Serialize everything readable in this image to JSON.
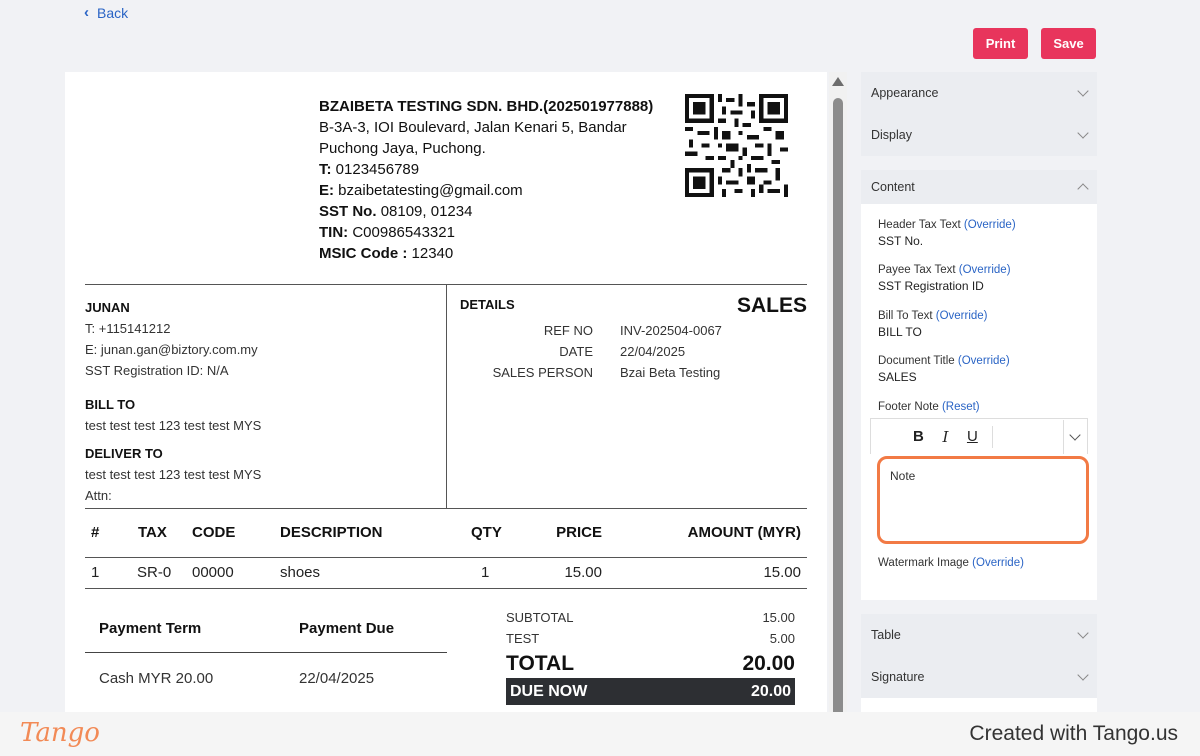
{
  "nav": {
    "back_label": "Back"
  },
  "actions": {
    "print_label": "Print",
    "save_label": "Save"
  },
  "invoice": {
    "company_name": "BZAIBETA TESTING SDN. BHD.(202501977888)",
    "address_line1": "B-3A-3, IOI Boulevard, Jalan Kenari 5, Bandar",
    "address_line2": "Puchong Jaya, Puchong.",
    "phone_label": "T:",
    "phone": "0123456789",
    "email_label": "E:",
    "email": "bzaibetatesting@gmail.com",
    "sst_label": "SST No.",
    "sst": "08109, 01234",
    "tin_label": "TIN:",
    "tin": "C00986543321",
    "msic_label": "MSIC Code :",
    "msic": "12340",
    "customer": {
      "name": "JUNAN",
      "phone": "T: +115141212",
      "email": "E: junan.gan@biztory.com.my",
      "sst": "SST Registration ID: N/A",
      "bill_to_label": "BILL TO",
      "bill_to": "test test test 123 test test MYS",
      "deliver_to_label": "DELIVER TO",
      "deliver_to": "test test test 123 test test MYS",
      "attn": "Attn:"
    },
    "details_label": "DETAILS",
    "doc_title": "SALES",
    "meta": [
      {
        "k": "REF NO",
        "v": "INV-202504-0067"
      },
      {
        "k": "DATE",
        "v": "22/04/2025"
      },
      {
        "k": "SALES PERSON",
        "v": "Bzai Beta Testing"
      }
    ],
    "table": {
      "headers": [
        "#",
        "TAX",
        "CODE",
        "DESCRIPTION",
        "QTY",
        "PRICE",
        "AMOUNT (MYR)"
      ],
      "rows": [
        [
          "1",
          "SR-0",
          "00000",
          "shoes",
          "1",
          "15.00",
          "15.00"
        ]
      ]
    },
    "payment": {
      "term_label": "Payment Term",
      "due_label": "Payment Due",
      "term": "Cash MYR 20.00",
      "due": "22/04/2025"
    },
    "totals": {
      "subtotal_label": "SUBTOTAL",
      "subtotal": "15.00",
      "test_label": "TEST",
      "test": "5.00",
      "total_label": "TOTAL",
      "total": "20.00",
      "due_now_label": "DUE NOW",
      "due_now": "20.00"
    }
  },
  "settings": {
    "appearance": "Appearance",
    "display": "Display",
    "content": "Content",
    "header_tax_label": "Header Tax Text",
    "header_tax_link": "(Override)",
    "header_tax_value": "SST No.",
    "payee_tax_label": "Payee Tax Text",
    "payee_tax_link": "(Override)",
    "payee_tax_value": "SST Registration ID",
    "bill_to_label": "Bill To Text",
    "bill_to_link": "(Override)",
    "bill_to_value": "BILL TO",
    "doc_title_label": "Document Title",
    "doc_title_link": "(Override)",
    "doc_title_value": "SALES",
    "footer_note_label": "Footer Note",
    "footer_note_link": "(Reset)",
    "editor_text": "Note",
    "watermark_label": "Watermark Image",
    "watermark_link": "(Override)",
    "table": "Table",
    "signature": "Signature"
  },
  "footer": {
    "brand": "Tango",
    "created": "Created with Tango.us"
  },
  "colors": {
    "accent": "#e8355c",
    "link": "#2a64c5",
    "highlight": "#f27a45"
  }
}
